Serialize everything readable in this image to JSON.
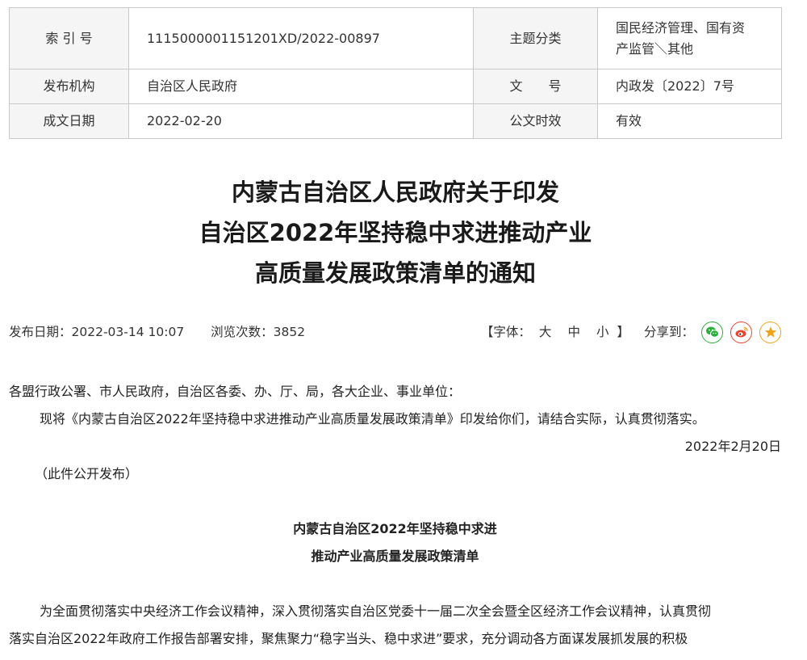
{
  "meta": {
    "index_label": "索 引 号",
    "index_value": "1115000001151201XD/2022-00897",
    "category_label": "主题分类",
    "category_value_line1": "国民经济管理、国有资",
    "category_value_line2": "产监管＼其他",
    "issuer_label": "发布机构",
    "issuer_value": "自治区人民政府",
    "docno_label": "文　　号",
    "docno_value": "内政发〔2022〕7号",
    "date_label": "成文日期",
    "date_value": "2022-02-20",
    "validity_label": "公文时效",
    "validity_value": "有效"
  },
  "title": {
    "line1": "内蒙古自治区人民政府关于印发",
    "line2": "自治区2022年坚持稳中求进推动产业",
    "line3": "高质量发展政策清单的通知"
  },
  "info": {
    "publish": "发布日期：2022-03-14 10:07",
    "views": "浏览次数：3852",
    "font_prefix": "【字体：",
    "font_large": "大",
    "font_medium": "中",
    "font_small": "小",
    "font_suffix": "】",
    "share_label": "分享到："
  },
  "share": {
    "wechat_color": "#2aae3a",
    "weibo_color": "#e6462e",
    "favorite_color": "#f0a21c"
  },
  "body": {
    "salutation": "各盟行政公署、市人民政府，自治区各委、办、厅、局，各大企业、事业单位：",
    "para1": "现将《内蒙古自治区2022年坚持稳中求进推动产业高质量发展政策清单》印发给你们，请结合实际，认真贯彻落实。",
    "date": "2022年2月20日",
    "note": "（此件公开发布）",
    "sub_title_line1": "内蒙古自治区2022年坚持稳中求进",
    "sub_title_line2": "推动产业高质量发展政策清单",
    "para2_line1": "为全面贯彻落实中央经济工作会议精神，深入贯彻落实自治区党委十一届二次全会暨全区经济工作会议精神，认真贯彻",
    "para2_line2": "落实自治区2022年政府工作报告部署安排，聚焦聚力“稳字当头、稳中求进”要求，充分调动各方面谋发展抓发展的积极"
  }
}
